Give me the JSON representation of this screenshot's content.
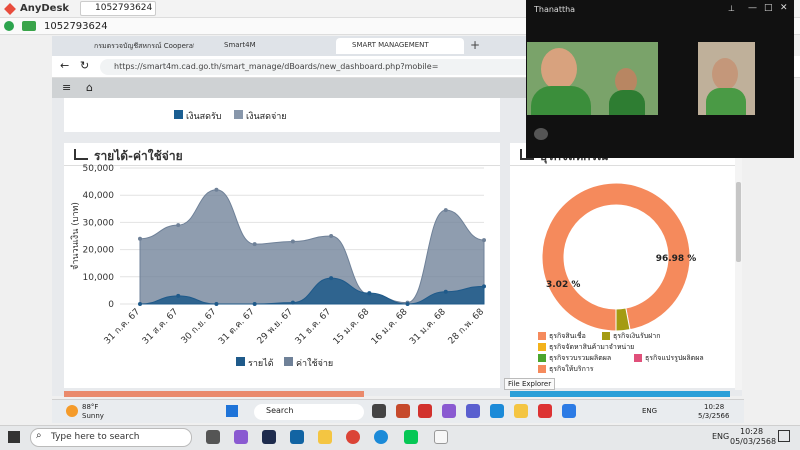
{
  "anydesk": {
    "app_name": "AnyDesk",
    "tab_id": "1052793624",
    "address_id": "1052793624"
  },
  "browser": {
    "tabs": [
      {
        "label": "กรมตรวจบัญชีสหกรณ์ Cooperative"
      },
      {
        "label": "Smart4M"
      },
      {
        "label": "SMART MANAGEMENT"
      }
    ],
    "url": "https://smart4m.cad.go.th/smart_manage/dBoards/new_dashboard.php?mobile="
  },
  "video_call": {
    "title": "Thanattha"
  },
  "top_legend": {
    "items": [
      {
        "label": "เงินสดรับ",
        "color": "#1a5e92"
      },
      {
        "label": "เงินสดจ่าย",
        "color": "#8897ab"
      }
    ]
  },
  "income_chart": {
    "heading": "รายได้-ค่าใช้จ่าย",
    "legend": [
      {
        "label": "รายได้",
        "color": "#1f5a8a"
      },
      {
        "label": "ค่าใช้จ่าย",
        "color": "#6f8198"
      }
    ]
  },
  "pie_panel": {
    "heading": "ธุรกิจสหกรณ์",
    "legend": [
      {
        "label": "ธุรกิจสินเชื่อ",
        "color": "#f58a5c"
      },
      {
        "label": "ธุรกิจเงินรับฝาก",
        "color": "#a49b12"
      },
      {
        "label": "ธุรกิจจัดหาสินค้ามาจำหน่าย",
        "color": "#f3b21b"
      },
      {
        "label": "ธุรกิจรวบรวมผลิตผล",
        "color": "#4aa52d"
      },
      {
        "label": "ธุรกิจแปรรูปผลิตผล",
        "color": "#e0507a"
      },
      {
        "label": "ธุรกิจให้บริการ",
        "color": "#f58a5c"
      }
    ]
  },
  "tooltip": "File Explorer",
  "inner_taskbar": {
    "weather_temp": "88°F",
    "weather_desc": "Sunny",
    "search": "Search",
    "lang": "ENG",
    "time": "10:28",
    "date": "5/3/2566"
  },
  "outer_taskbar": {
    "search": "Type here to search",
    "lang": "ENG",
    "time": "10:28",
    "date": "05/03/2568"
  },
  "chart_data": [
    {
      "type": "area",
      "title": "รายได้-ค่าใช้จ่าย",
      "ylabel": "จำนวนเงิน (บาท)",
      "ylim": [
        0,
        50000
      ],
      "yticks": [
        "0",
        "10,000",
        "20,000",
        "30,000",
        "40,000",
        "50,000"
      ],
      "categories": [
        "31 ก.ค. 67",
        "31 ส.ค. 67",
        "30 ก.ย. 67",
        "31 ต.ค. 67",
        "29 พ.ย. 67",
        "31 ธ.ค. 67",
        "15 ม.ค. 68",
        "16 ม.ค. 68",
        "31 ม.ค. 68",
        "28 ก.พ. 68"
      ],
      "series": [
        {
          "name": "ค่าใช้จ่าย",
          "color": "#6f8198",
          "values": [
            24000,
            29000,
            42000,
            22000,
            23000,
            25000,
            3500,
            500,
            34500,
            23500
          ]
        },
        {
          "name": "รายได้",
          "color": "#1f5a8a",
          "values": [
            0,
            3000,
            0,
            0,
            500,
            9500,
            4000,
            0,
            4500,
            6500
          ]
        }
      ]
    },
    {
      "type": "pie",
      "slices": [
        {
          "name": "ธุรกิจสินเชื่อ",
          "value": 96.98,
          "label": "96.98 %",
          "color": "#f58a5c"
        },
        {
          "name": "ธุรกิจเงินรับฝาก",
          "value": 3.02,
          "label": "3.02 %",
          "color": "#a49b12"
        }
      ]
    }
  ]
}
